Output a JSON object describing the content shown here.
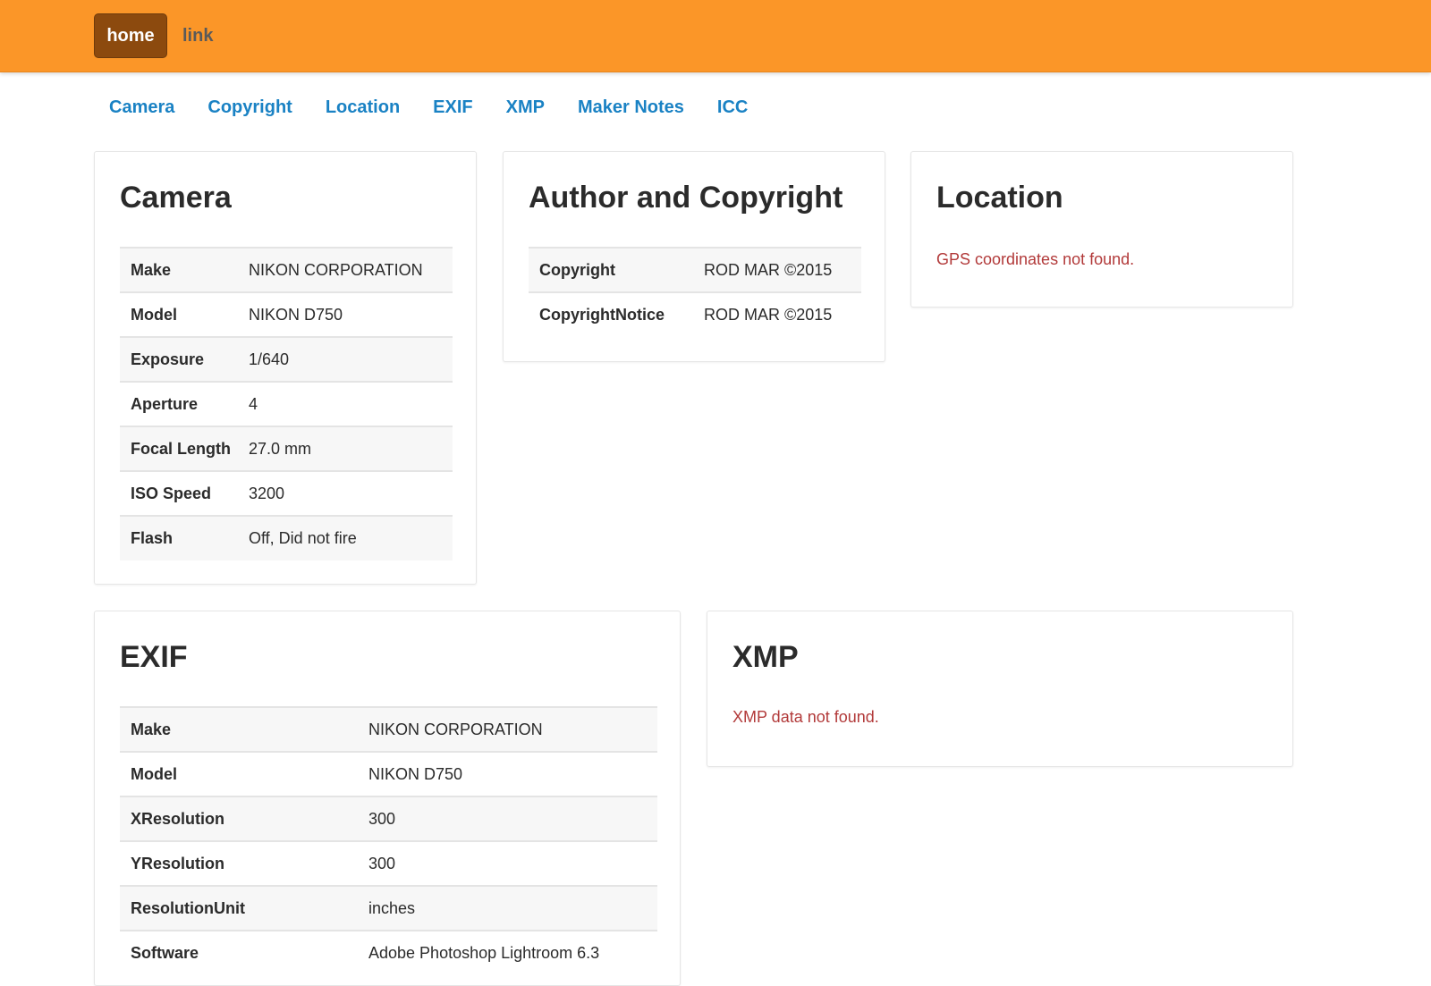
{
  "nav": {
    "home": "home",
    "link": "link"
  },
  "subnav": [
    "Camera",
    "Copyright",
    "Location",
    "EXIF",
    "XMP",
    "Maker Notes",
    "ICC"
  ],
  "camera": {
    "title": "Camera",
    "rows": [
      {
        "key": "Make",
        "value": "NIKON CORPORATION"
      },
      {
        "key": "Model",
        "value": "NIKON D750"
      },
      {
        "key": "Exposure",
        "value": "1/640"
      },
      {
        "key": "Aperture",
        "value": "4"
      },
      {
        "key": "Focal Length",
        "value": "27.0 mm"
      },
      {
        "key": "ISO Speed",
        "value": "3200"
      },
      {
        "key": "Flash",
        "value": "Off, Did not fire"
      }
    ]
  },
  "copyright": {
    "title": "Author and Copyright",
    "rows": [
      {
        "key": "Copyright",
        "value": "ROD MAR ©2015"
      },
      {
        "key": "CopyrightNotice",
        "value": "ROD MAR ©2015"
      }
    ]
  },
  "location": {
    "title": "Location",
    "message": "GPS coordinates not found."
  },
  "exif": {
    "title": "EXIF",
    "rows": [
      {
        "key": "Make",
        "value": "NIKON CORPORATION"
      },
      {
        "key": "Model",
        "value": "NIKON D750"
      },
      {
        "key": "XResolution",
        "value": "300"
      },
      {
        "key": "YResolution",
        "value": "300"
      },
      {
        "key": "ResolutionUnit",
        "value": "inches"
      },
      {
        "key": "Software",
        "value": "Adobe Photoshop Lightroom 6.3"
      }
    ]
  },
  "xmp": {
    "title": "XMP",
    "message": "XMP data not found."
  },
  "colors": {
    "topbar": "#fb9628",
    "home_button": "#8c4a0e",
    "link": "#1a82c4",
    "error": "#b23a3a"
  }
}
